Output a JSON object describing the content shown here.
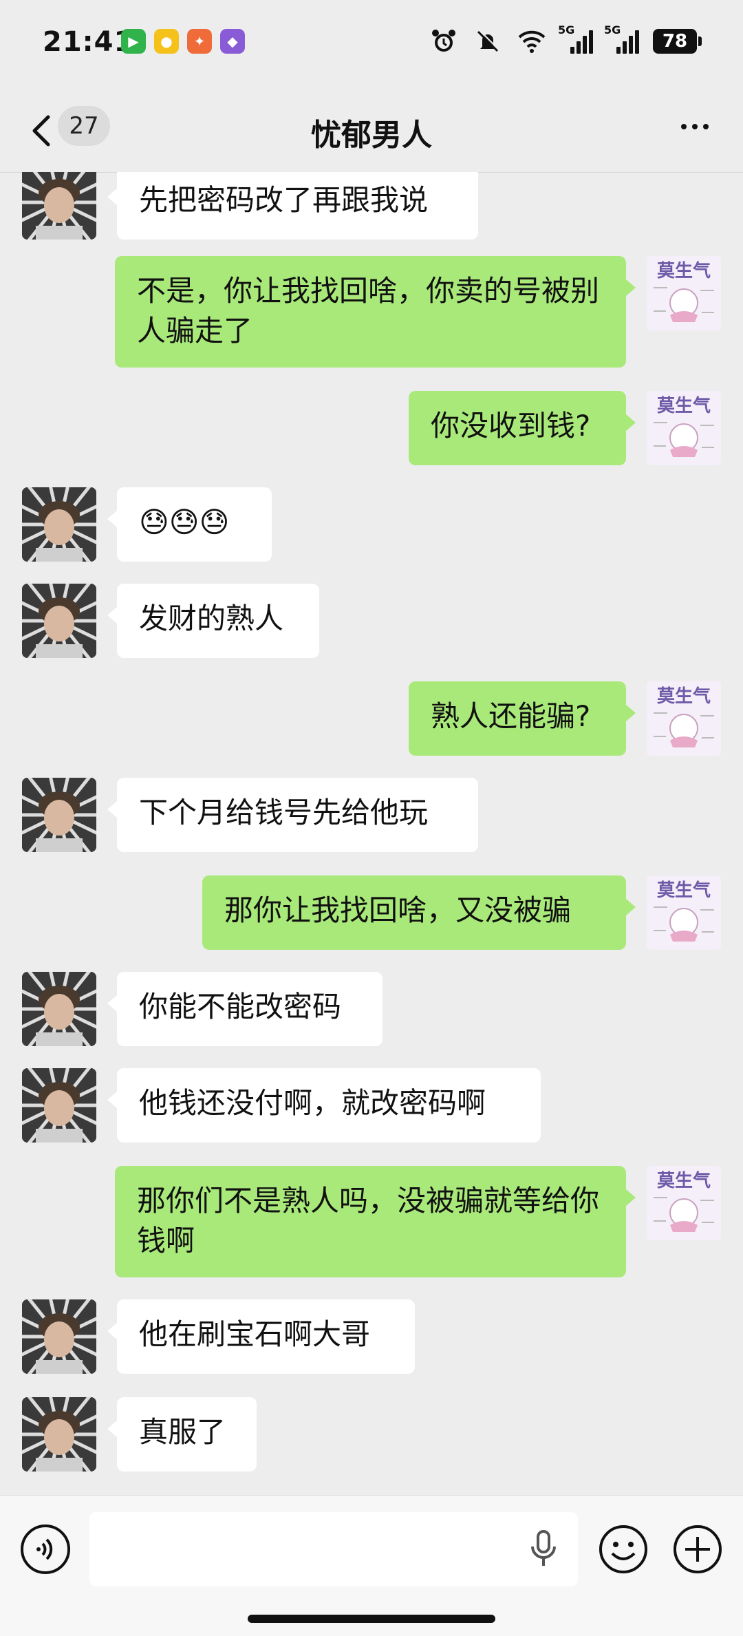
{
  "status_bar": {
    "time": "21:41",
    "battery": "78",
    "network_1": "5G",
    "network_2": "5G"
  },
  "nav": {
    "back_count": "27",
    "title": "忧郁男人"
  },
  "sticker_text": "莫生气",
  "messages": [
    {
      "side": "left",
      "text": "先把密码改了再跟我说"
    },
    {
      "side": "right",
      "text": "不是，你让我找回啥，你卖的号被别人骗走了"
    },
    {
      "side": "right",
      "text": "你没收到钱?"
    },
    {
      "side": "left",
      "text": "😓😓😓"
    },
    {
      "side": "left",
      "text": "发财的熟人"
    },
    {
      "side": "right",
      "text": "熟人还能骗?"
    },
    {
      "side": "left",
      "text": "下个月给钱号先给他玩"
    },
    {
      "side": "right",
      "text": "那你让我找回啥，又没被骗"
    },
    {
      "side": "left",
      "text": "你能不能改密码"
    },
    {
      "side": "left",
      "text": "他钱还没付啊，就改密码啊"
    },
    {
      "side": "right",
      "text": "那你们不是熟人吗，没被骗就等给你钱啊"
    },
    {
      "side": "left",
      "text": "他在刷宝石啊大哥"
    },
    {
      "side": "left",
      "text": "真服了"
    }
  ],
  "input": {
    "value": "",
    "placeholder": ""
  },
  "icons": {
    "voice": "voice-icon",
    "mic": "mic-icon",
    "emoji": "emoji-icon",
    "plus": "plus-icon"
  },
  "colors": {
    "background": "#ededed",
    "bubble_self": "#a9e97a",
    "bubble_other": "#ffffff"
  }
}
